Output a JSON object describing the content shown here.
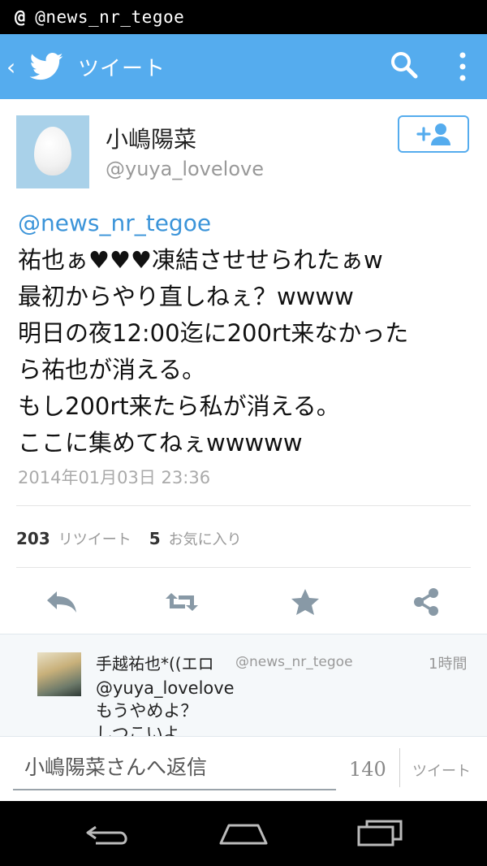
{
  "status_bar": {
    "at_symbol": "@",
    "handle": "@news_nr_tegoe"
  },
  "app_bar": {
    "back": "‹",
    "title": "ツイート"
  },
  "tweet": {
    "display_name": "小嶋陽菜",
    "username": "@yuya_lovelove",
    "mention": "@news_nr_tegoe",
    "lines": [
      "祐也ぁ♥♥♥凍結させせられたぁw",
      "最初からやり直しねぇ？wwww",
      "明日の夜12:00迄に200rt来なかった",
      "ら祐也が消える。",
      "もし200rt来たら私が消える。",
      "ここに集めてねぇwwwww"
    ],
    "timestamp": "2014年01月03日 23:36",
    "stats": {
      "retweet_count": "203",
      "retweet_label": "リツイート",
      "favorite_count": "5",
      "favorite_label": "お気に入り"
    }
  },
  "reply": {
    "display_name": "手越祐也*((エロ",
    "handle": "@news_nr_tegoe",
    "time": "1時間",
    "lines": [
      "@yuya_lovelove",
      "もうやめよ？",
      "しつこいよ"
    ]
  },
  "composer": {
    "placeholder": "小嶋陽菜さんへ返信",
    "char_count": "140",
    "tweet_button": "ツイート"
  },
  "colors": {
    "brand_blue": "#55acee",
    "link_blue": "#3b94d9",
    "action_gray": "#8899a6"
  },
  "icons": [
    "twitter-bird-icon",
    "search-icon",
    "more-vert-icon",
    "add-user-icon",
    "reply-icon",
    "retweet-icon",
    "favorite-star-icon",
    "share-icon",
    "nav-back-icon",
    "nav-home-icon",
    "nav-recents-icon"
  ]
}
